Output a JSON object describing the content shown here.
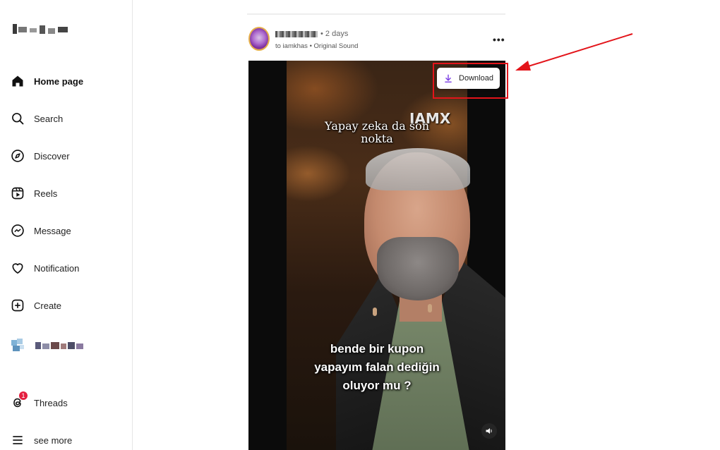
{
  "sidebar": {
    "items": [
      {
        "label": "Home page",
        "icon": "home-icon",
        "active": true
      },
      {
        "label": "Search",
        "icon": "search-icon"
      },
      {
        "label": "Discover",
        "icon": "compass-icon"
      },
      {
        "label": "Reels",
        "icon": "reels-icon"
      },
      {
        "label": "Message",
        "icon": "messenger-icon"
      },
      {
        "label": "Notification",
        "icon": "heart-icon"
      },
      {
        "label": "Create",
        "icon": "plus-square-icon"
      },
      {
        "label": "Threads",
        "icon": "threads-icon",
        "badge": "1"
      },
      {
        "label": "see more",
        "icon": "menu-icon"
      }
    ]
  },
  "post": {
    "timeago": "• 2 days",
    "subline": "to iamkhas • Original Sound",
    "more": "•••",
    "caption_top": [
      "Yapay zeka da son",
      "nokta"
    ],
    "watermark": "IAMX",
    "caption_bottom": [
      "bende bir kupon",
      "yapayım falan dediğin",
      "oluyor mu ?"
    ]
  },
  "download": {
    "label": "Download"
  },
  "colors": {
    "accent_purple": "#7b3fe4",
    "highlight_red": "#e3141a",
    "badge_red": "#e41e3f"
  }
}
